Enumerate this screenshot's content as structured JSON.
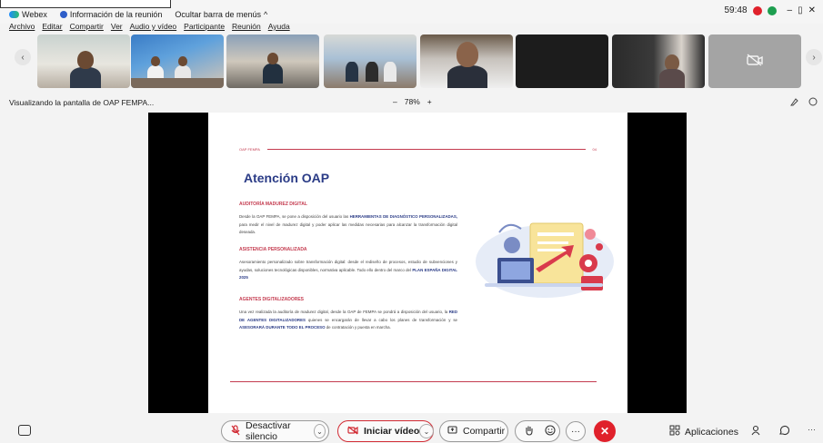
{
  "titlebar": {
    "app_name": "Webex",
    "meeting_info": "Información de la reunión",
    "hide_menu": "Ocultar barra de menús",
    "hide_menu_chevron": "^",
    "timer": "59:48",
    "minimize": "–",
    "restore": "▯",
    "close": "✕"
  },
  "menu": {
    "items": [
      "Archivo",
      "Editar",
      "Compartir",
      "Ver",
      "Audio y vídeo",
      "Participante",
      "Reunión",
      "Ayuda"
    ]
  },
  "strip": {
    "prev": "‹",
    "next": "›",
    "video_off_icon": "camera-off-icon"
  },
  "viewer": {
    "label": "Visualizando la pantalla de OAP FEMPA...",
    "zoom_out": "–",
    "zoom_level": "78%",
    "zoom_in": "+"
  },
  "slide": {
    "header_left": "OAP FEMPA",
    "page_number": "04",
    "title": "Atención OAP",
    "sections": [
      {
        "heading": "AUDITORÍA MADUREZ DIGITAL",
        "body_pre": "Desde la OAP FEMPA, se pone a disposición del usuario las ",
        "body_bold": "HERRAMIENTAS DE DIAGNÓSTICO PERSONALIZADAS,",
        "body_post": " para medir el nivel de madurez digital y poder aplicar las medidas necesarias para alcanzar la transformación digital deseada."
      },
      {
        "heading": "ASISTENCIA PERSONALIZADA",
        "body_pre": "Asesoramiento personalizado sobre transformación digital: desde el rediseño de procesos, estudio de subvenciones y ayudas, soluciones tecnológicas disponibles, normativa aplicable. Todo ello dentro del marco del ",
        "body_bold": "PLAN ESPAÑA DIGITAL 2025",
        "body_post": ""
      },
      {
        "heading": "AGENTES DIGITALIZADORES",
        "body_pre": "Una vez realizada la auditoría de madurez digital, desde la OAP de FEMPA se pondrá a disposición del usuario, la ",
        "body_bold": "RED DE AGENTES DIGITALIZADORES",
        "body_mid": " quienes se encargarán de llevar a cabo los planes de transformación y se ",
        "body_bold2": "ASESORARÁ DURANTE TODO EL PROCESO",
        "body_post": " de contratación y puesta en marcha."
      }
    ]
  },
  "controls": {
    "mute_label": "Desactivar silencio",
    "video_label": "Iniciar vídeo",
    "share_label": "Compartir",
    "more": "···",
    "end": "✕",
    "apps_label": "Aplicaciones",
    "chevron": "⌄",
    "colors": {
      "end_call": "#e0212b",
      "accent": "#c43b4f",
      "title_blue": "#2a3b86"
    }
  }
}
